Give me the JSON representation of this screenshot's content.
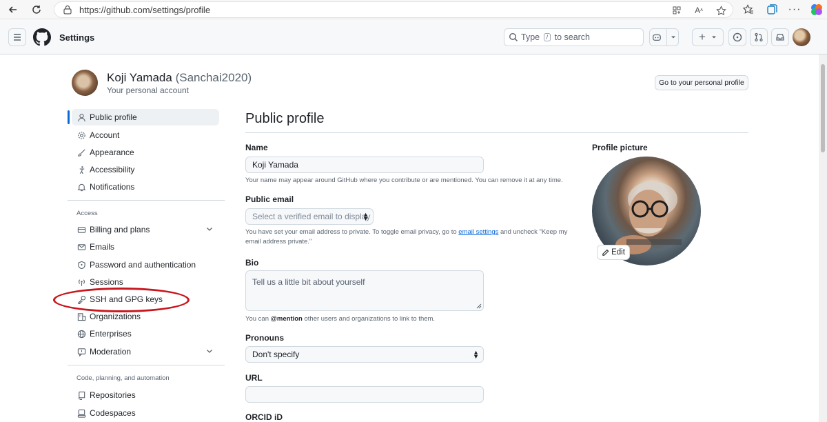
{
  "browser": {
    "url": "https://github.com/settings/profile"
  },
  "header": {
    "title": "Settings",
    "search_placeholder_pre": "Type",
    "search_key": "/",
    "search_placeholder_post": "to search"
  },
  "user": {
    "name": "Koji Yamada",
    "login": "(Sanchai2020)",
    "subtitle": "Your personal account",
    "go_profile_label": "Go to your personal profile"
  },
  "sidebar": {
    "items": [
      {
        "label": "Public profile",
        "icon": "person-icon"
      },
      {
        "label": "Account",
        "icon": "gear-icon"
      },
      {
        "label": "Appearance",
        "icon": "paintbrush-icon"
      },
      {
        "label": "Accessibility",
        "icon": "accessibility-icon"
      },
      {
        "label": "Notifications",
        "icon": "bell-icon"
      }
    ],
    "access_heading": "Access",
    "access_items": [
      {
        "label": "Billing and plans",
        "icon": "credit-card-icon"
      },
      {
        "label": "Emails",
        "icon": "mail-icon"
      },
      {
        "label": "Password and authentication",
        "icon": "shield-lock-icon"
      },
      {
        "label": "Sessions",
        "icon": "broadcast-icon"
      },
      {
        "label": "SSH and GPG keys",
        "icon": "key-icon"
      },
      {
        "label": "Organizations",
        "icon": "organization-icon"
      },
      {
        "label": "Enterprises",
        "icon": "globe-icon"
      },
      {
        "label": "Moderation",
        "icon": "report-icon"
      }
    ],
    "code_heading": "Code, planning, and automation",
    "code_items": [
      {
        "label": "Repositories",
        "icon": "repo-icon"
      },
      {
        "label": "Codespaces",
        "icon": "codespaces-icon"
      }
    ]
  },
  "main": {
    "title": "Public profile",
    "name_label": "Name",
    "name_value": "Koji Yamada",
    "name_note": "Your name may appear around GitHub where you contribute or are mentioned. You can remove it at any time.",
    "email_label": "Public email",
    "email_select": "Select a verified email to display",
    "email_note_pre": "You have set your email address to private. To toggle email privacy, go to ",
    "email_note_link": "email settings",
    "email_note_post": " and uncheck \"Keep my email address private.\"",
    "bio_label": "Bio",
    "bio_placeholder": "Tell us a little bit about yourself",
    "bio_note_pre": "You can ",
    "bio_note_mention": "@mention",
    "bio_note_post": " other users and organizations to link to them.",
    "pronouns_label": "Pronouns",
    "pronouns_value": "Don't specify",
    "url_label": "URL",
    "url_value": "",
    "orcid_label": "ORCID iD"
  },
  "profile_picture": {
    "label": "Profile picture",
    "edit_label": "Edit"
  },
  "colors": {
    "accent": "#0969da",
    "annotation": "#c8161d"
  }
}
